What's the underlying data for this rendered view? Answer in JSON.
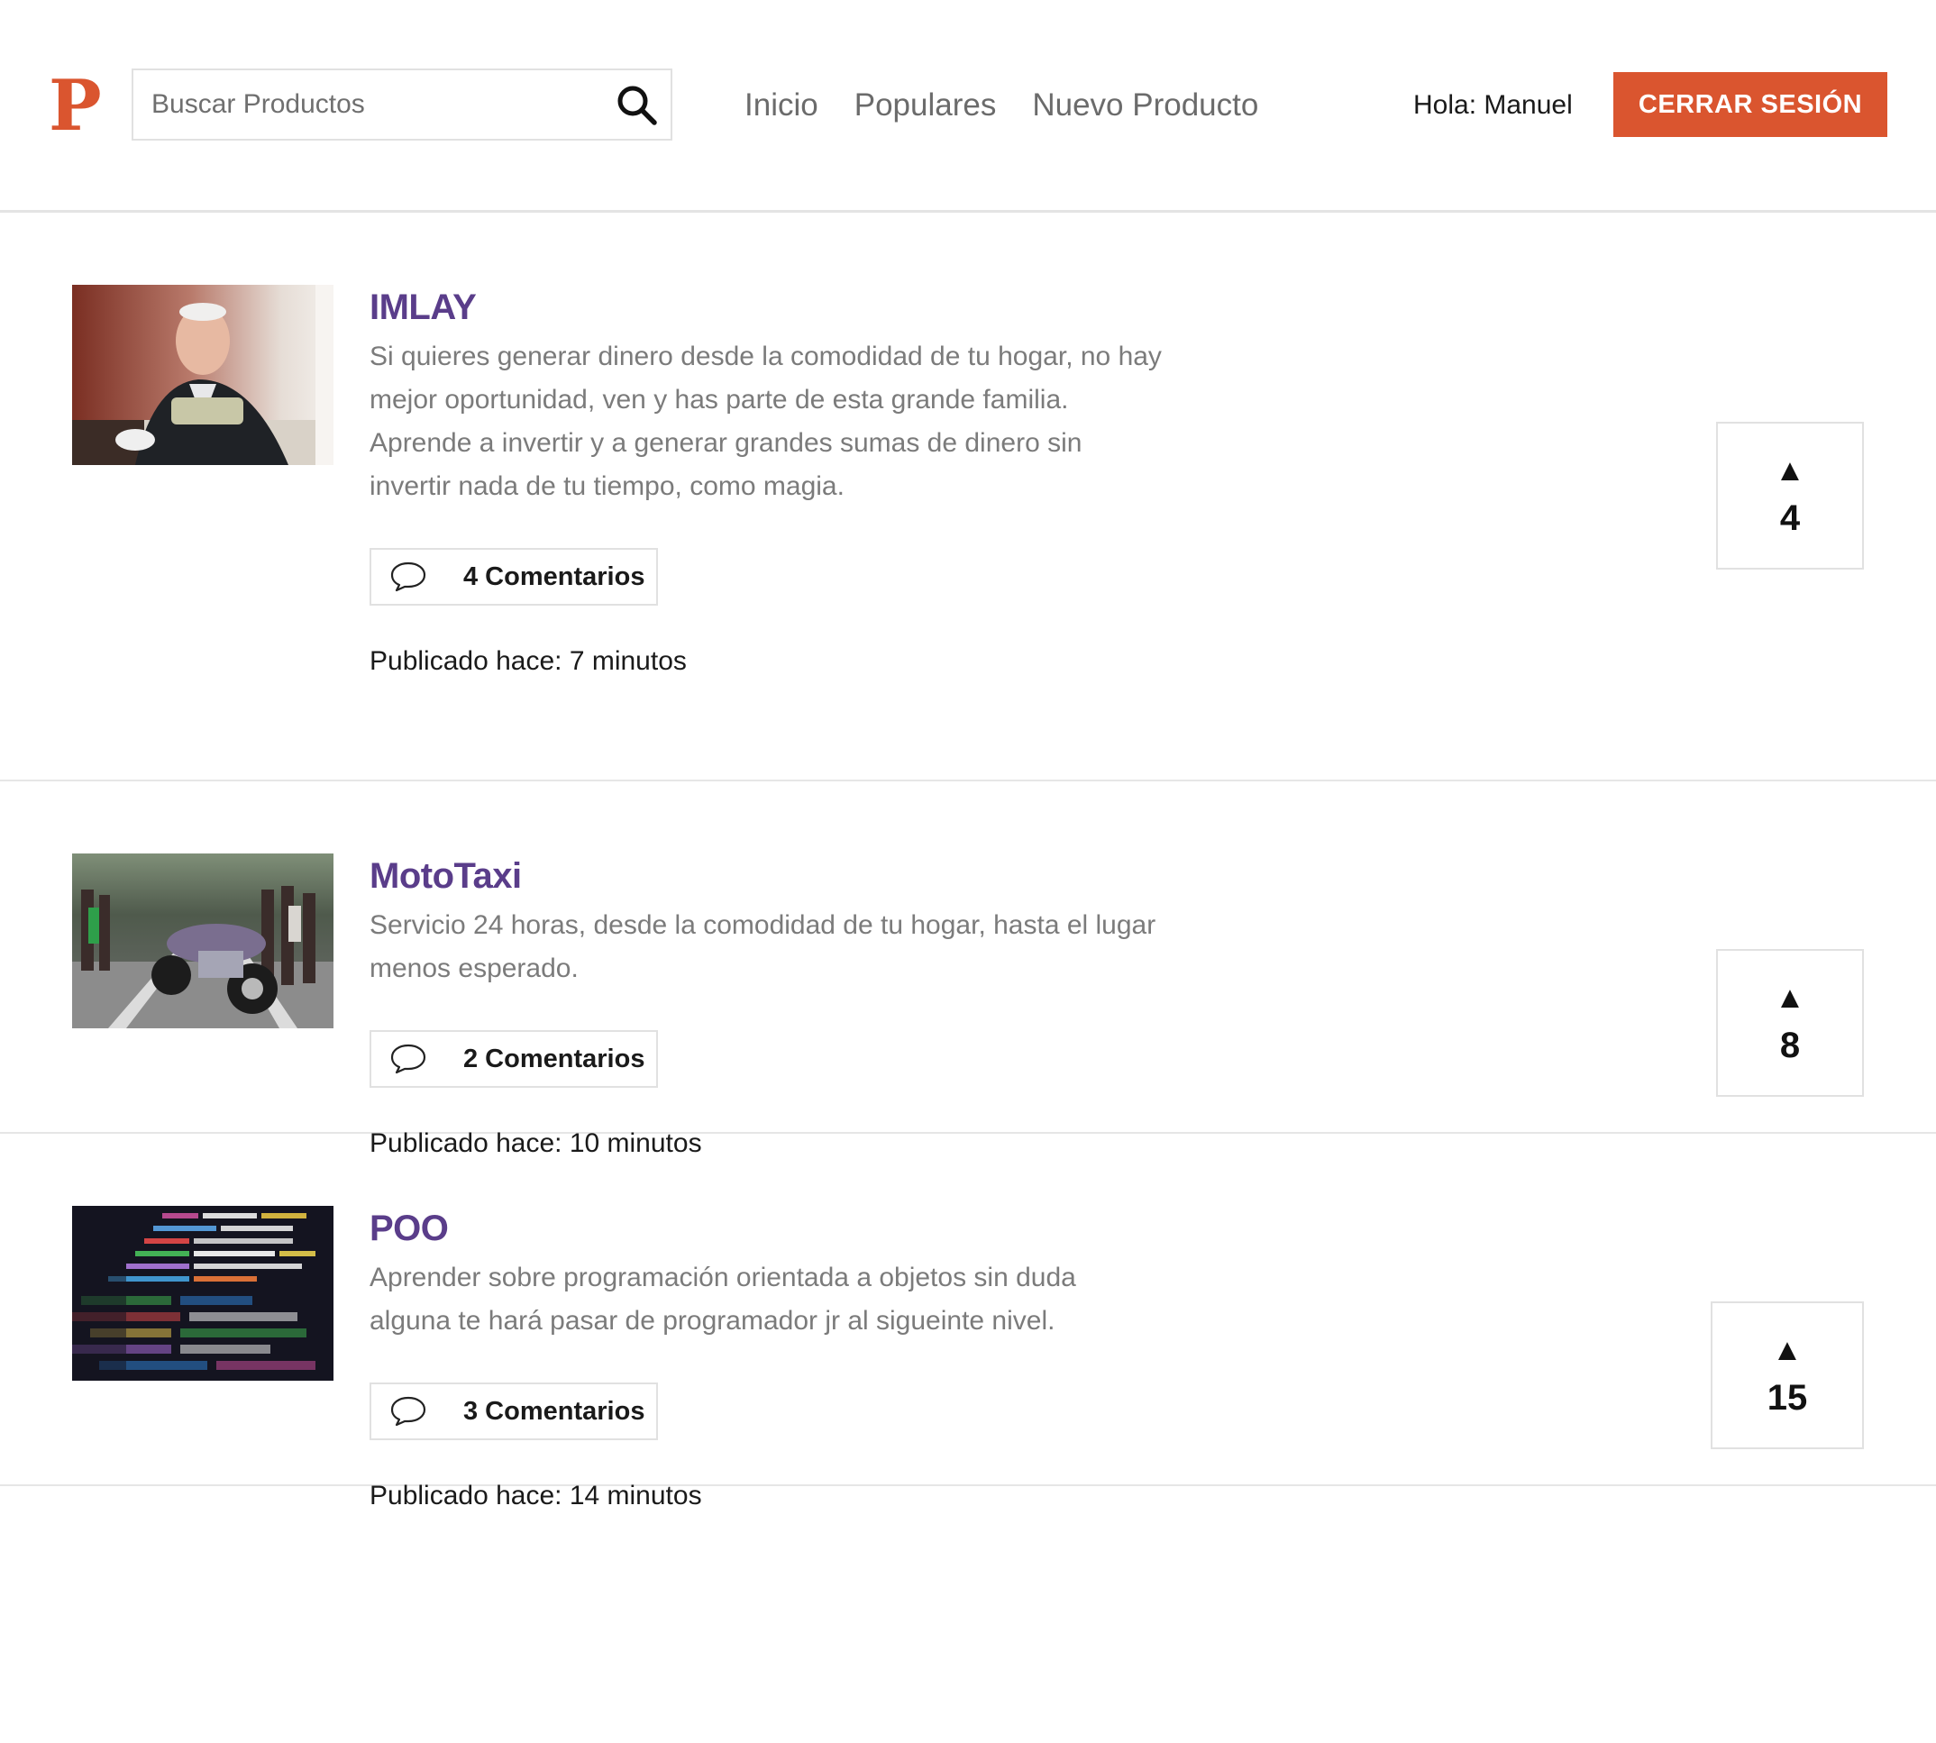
{
  "header": {
    "logo_letter": "P",
    "search": {
      "placeholder": "Buscar Productos",
      "value": ""
    },
    "nav": [
      {
        "label": "Inicio"
      },
      {
        "label": "Populares"
      },
      {
        "label": "Nuevo Producto"
      }
    ],
    "greeting": "Hola: Manuel",
    "logout_label": "CERRAR SESIÓN"
  },
  "colors": {
    "brand": "#da552f",
    "title": "#5a3d8a",
    "description": "#7b7b7b"
  },
  "products": [
    {
      "title": "IMLAY",
      "description": "Si quieres generar dinero desde la comodidad de tu hogar, no hay mejor oportunidad, ven y has parte de esta grande familia. Aprende a invertir y a generar grandes sumas de dinero sin invertir nada de tu tiempo, como magia.",
      "comments_label": "4 Comentarios",
      "published": "Publicado hace: 7 minutos",
      "votes": "4",
      "image": "elderly-man-counting-money-photo"
    },
    {
      "title": "MotoTaxi",
      "description": "Servicio 24 horas, desde la comodidad de tu hogar, hasta el lugar menos esperado.",
      "comments_label": "2 Comentarios",
      "published": "Publicado hace: 10 minutos",
      "votes": "8",
      "image": "motorcycle-crowd-street-photo"
    },
    {
      "title": "POO",
      "description": "Aprender sobre programación orientada a objetos sin duda alguna te hará pasar de programador jr al sigueinte nivel.",
      "comments_label": "3 Comentarios",
      "published": "Publicado hace: 14 minutos",
      "votes": "15",
      "image": "code-screen-photo"
    }
  ],
  "icons": {
    "search": "search-icon",
    "comment": "speech-bubble-icon",
    "vote": "up-triangle-icon",
    "vote_glyph": "▲"
  }
}
